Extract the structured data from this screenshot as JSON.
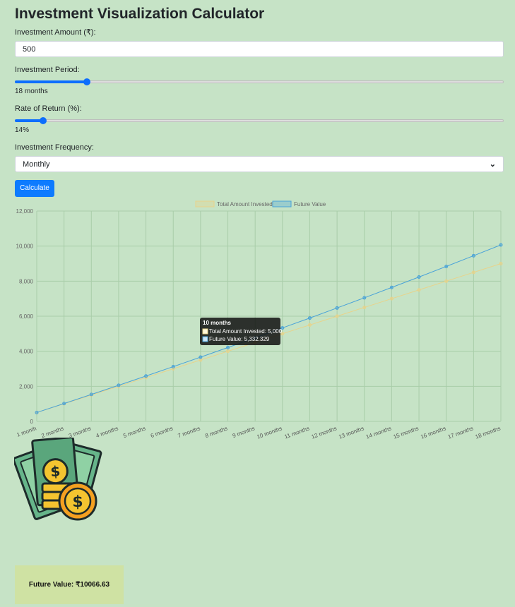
{
  "page": {
    "title": "Investment Visualization Calculator"
  },
  "form": {
    "amount_label": "Investment Amount (₹):",
    "amount_value": "500",
    "period_label": "Investment Period:",
    "period_value_text": "18 months",
    "period_fraction": 0.148,
    "rate_label": "Rate of Return (%):",
    "rate_value_text": "14%",
    "rate_fraction": 0.058,
    "frequency_label": "Investment Frequency:",
    "frequency_selected": "Monthly",
    "calculate_label": "Calculate"
  },
  "chart_data": {
    "type": "line",
    "categories": [
      "1 month",
      "2 months",
      "3 months",
      "4 months",
      "5 months",
      "6 months",
      "7 months",
      "8 months",
      "9 months",
      "10 months",
      "11 months",
      "12 months",
      "13 months",
      "14 months",
      "15 months",
      "16 months",
      "17 months",
      "18 months"
    ],
    "series": [
      {
        "name": "Total Amount Invested",
        "color": "#e8d38a",
        "values": [
          500,
          1000,
          1500,
          2000,
          2500,
          3000,
          3500,
          4000,
          4500,
          5000,
          5500,
          6000,
          6500,
          7000,
          7500,
          8000,
          8500,
          9000
        ]
      },
      {
        "name": "Future Value",
        "color": "#4aa3d8",
        "values": [
          505,
          1017,
          1535,
          2058,
          2588,
          3123,
          3665,
          4213,
          4768,
          5332,
          5895,
          6470,
          7050,
          7640,
          8235,
          8840,
          9450,
          10066.63
        ]
      }
    ],
    "yticks": [
      "0",
      "2,000",
      "4,000",
      "6,000",
      "8,000",
      "10,000",
      "12,000"
    ],
    "ylim": [
      0,
      12000
    ],
    "grid": true,
    "legend": "top",
    "tooltip": {
      "title": "10 months",
      "line1": "Total Amount Invested: 5,000",
      "line2": "Future Value: 5,332.329"
    }
  },
  "result": {
    "text": "Future Value: ₹10066.63"
  },
  "decor": {
    "icon": "money-coins-icon"
  }
}
